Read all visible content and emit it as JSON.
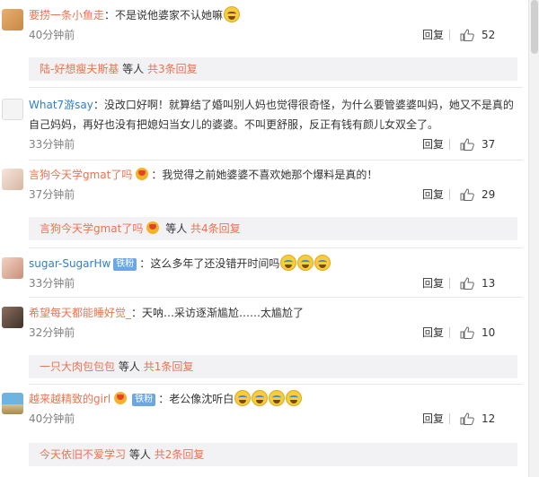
{
  "comments": [
    {
      "user": "要捞一条小鱼走",
      "text": "不是说他婆家不认她嘛",
      "emojis": [
        "grin-emoji"
      ],
      "time": "40分钟前",
      "reply": "回复",
      "likes": "52",
      "sub": {
        "users": "陆-好想瘦夫斯基",
        "mid": "等人",
        "more": "共3条回复"
      }
    },
    {
      "user": "What7游say",
      "text": "没改口好啊！就算结了婚叫别人妈也觉得很奇怪，为什么要管婆婆叫妈，她又不是真的自己妈妈，再好也没有把媳妇当女儿的婆婆。不叫更舒服，反正有钱有颜儿女双全了。",
      "time": "33分钟前",
      "reply": "回复",
      "likes": "37"
    },
    {
      "user": "言狗今天学gmat了吗",
      "text": "我觉得之前她婆婆不喜欢她那个爆料是真的！",
      "time": "37分钟前",
      "reply": "回复",
      "likes": "29",
      "sub": {
        "users": "言狗今天学gmat了吗",
        "mid": "等人",
        "more": "共4条回复"
      }
    },
    {
      "user": "sugar-SugarHw",
      "badge": "铁粉",
      "text": "这么多年了还没错开时间吗",
      "time": "33分钟前",
      "reply": "回复",
      "likes": "13"
    },
    {
      "user": "希望每天都能睡好觉_",
      "text": "天呐…采访逐渐尴尬……太尴尬了",
      "time": "32分钟前",
      "reply": "回复",
      "likes": "10",
      "sub": {
        "users": "一只大肉包包包",
        "mid": "等人",
        "more": "共1条回复"
      }
    },
    {
      "user": "越来越精致的girl",
      "badge": "铁粉",
      "text": "老公像沈听白",
      "time": "40分钟前",
      "reply": "回复",
      "likes": "12",
      "sub": {
        "users": "今天依旧不爱学习",
        "mid": "等人",
        "more": "共2条回复"
      }
    }
  ],
  "colors": {
    "username": "#eb7350",
    "badge": "#6ca7e3",
    "subpanel": "#f2f2f5"
  }
}
